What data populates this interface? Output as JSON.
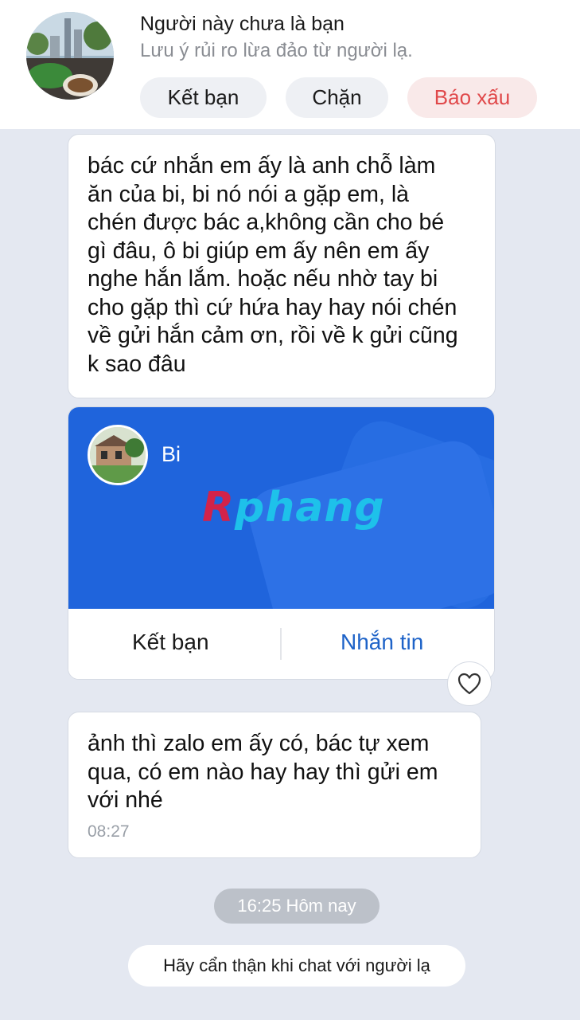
{
  "header": {
    "title": "Người này chưa là bạn",
    "subtitle": "Lưu ý rủi ro lừa đảo từ người lạ.",
    "add_friend_label": "Kết bạn",
    "block_label": "Chặn",
    "report_label": "Báo xấu"
  },
  "messages": [
    {
      "text": "bác cứ nhắn em ấy là anh chỗ làm\năn của bi, bi nó nói a gặp em, là\nchén được bác a,không cần cho bé\ngì đâu,  ô bi giúp em ấy nên em ấy\nnghe hắn lắm. hoặc nếu nhờ tay bi\ncho gặp thì cứ hứa hay hay nói chén\nvề gửi hắn cảm ơn, rồi về k gửi cũng\nk sao đâu"
    },
    {
      "text": "ảnh thì zalo em ấy có, bác tự xem\nqua, có em nào hay hay thì gửi em\nvới nhé",
      "time": "08:27"
    }
  ],
  "contact_card": {
    "name": "Bi",
    "watermark_first": "R",
    "watermark_rest": "phang",
    "add_friend_label": "Kết bạn",
    "message_label": "Nhắn tin",
    "reaction_icon": "heart-icon"
  },
  "date_separator": "16:25 Hôm nay",
  "warning": "Hãy cẩn thận khi chat với người lạ",
  "colors": {
    "card_blue": "#1f64dc",
    "report_red": "#e0484a",
    "link_blue": "#1e63c8",
    "chat_bg": "#e4e8f1"
  }
}
